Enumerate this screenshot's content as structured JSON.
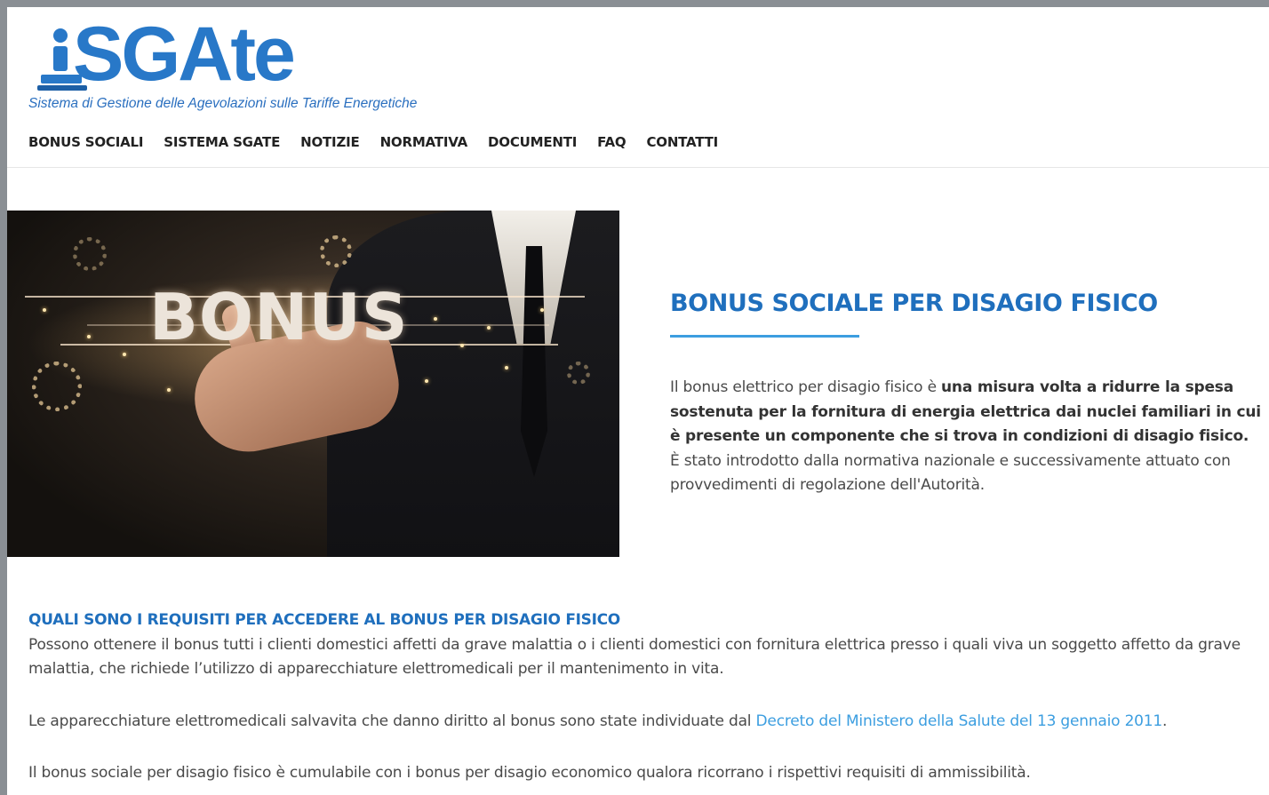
{
  "header": {
    "logo_text": "SGAte",
    "logo_subtitle": "Sistema di Gestione delle Agevolazioni sulle Tariffe Energetiche",
    "brand_color": "#2878c8"
  },
  "nav": {
    "items": [
      {
        "label": "BONUS SOCIALI"
      },
      {
        "label": "SISTEMA SGATE"
      },
      {
        "label": "NOTIZIE"
      },
      {
        "label": "NORMATIVA"
      },
      {
        "label": "DOCUMENTI"
      },
      {
        "label": "FAQ"
      },
      {
        "label": "CONTATTI"
      }
    ]
  },
  "hero": {
    "image_text": "BONUS"
  },
  "main": {
    "title": "BONUS SOCIALE PER DISAGIO FISICO",
    "intro_start": "Il bonus elettrico per disagio fisico è ",
    "intro_bold": "una misura volta a ridurre la spesa sostenuta per la fornitura di energia elettrica dai nuclei familiari in cui è presente un componente che si trova in condizioni di disagio fisico.",
    "intro_end": " È stato introdotto dalla normativa nazionale e successivamente attuato con provvedimenti di regolazione dell'Autorità.",
    "title_color": "#1f6fbd",
    "accent_color": "#3c9ee0"
  },
  "requirements": {
    "heading": "QUALI SONO I REQUISITI PER ACCEDERE AL BONUS PER DISAGIO FISICO",
    "para1": "Possono ottenere il bonus tutti i clienti domestici affetti da grave malattia o i clienti domestici con fornitura elettrica presso i quali viva un soggetto affetto da grave malattia, che richiede l’utilizzo di apparecchiature elettromedicali per il mantenimento in vita.",
    "para2_start": "Le apparecchiature elettromedicali salvavita che danno diritto al bonus sono state individuate dal ",
    "para2_link": "Decreto del Ministero della Salute del 13 gennaio 2011",
    "para2_end": ".",
    "para3": "Il bonus sociale per disagio fisico è cumulabile con i bonus per disagio economico qualora ricorrano i rispettivi requisiti di ammissibilità."
  }
}
